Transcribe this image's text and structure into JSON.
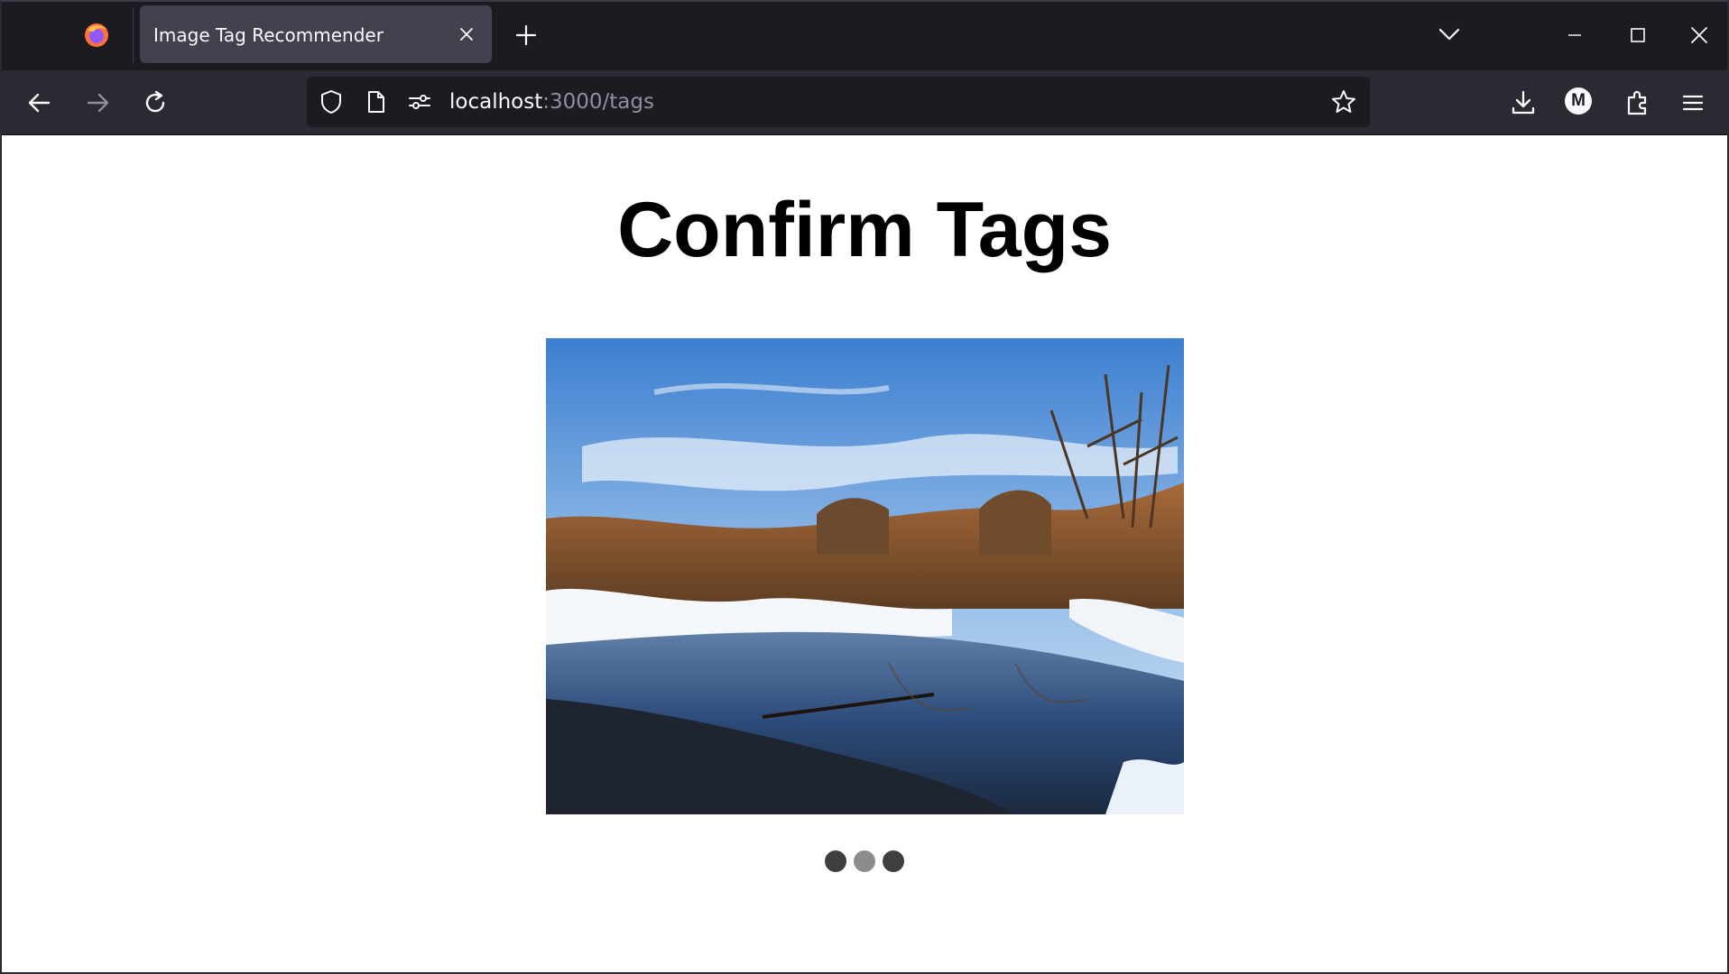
{
  "browser": {
    "tab": {
      "title": "Image Tag Recommender"
    },
    "url": {
      "host": "localhost",
      "path": ":3000/tags"
    },
    "profile": {
      "initial": "M"
    },
    "icons": {
      "app": "firefox-logo-icon",
      "tab_close": "close-icon",
      "new_tab": "plus-icon",
      "tab_list": "chevron-down-icon",
      "minimize": "minimize-icon",
      "maximize": "maximize-icon",
      "window_close": "close-icon",
      "back": "arrow-left-icon",
      "forward": "arrow-right-icon",
      "reload": "reload-icon",
      "tracking": "shield-icon",
      "page": "page-icon",
      "permissions": "permissions-icon",
      "bookmark": "star-icon",
      "downloads": "download-icon",
      "extensions": "puzzle-icon",
      "menu": "hamburger-menu-icon"
    },
    "colors": {
      "chrome_dark": "#1c1b22",
      "toolbar": "#2b2a33",
      "tab_active": "#42414d",
      "text": "#fbfbfe",
      "text_muted": "#8f8f9d"
    }
  },
  "page": {
    "heading": "Confirm Tags",
    "image": {
      "subject": "winter river landscape with snow, reeds and bare trees under a blue sky"
    },
    "carousel": {
      "count": 3,
      "dots": [
        {
          "state": "dark",
          "color": "#3f3f3f"
        },
        {
          "state": "active",
          "color": "#8c8c8c"
        },
        {
          "state": "dark",
          "color": "#3f3f3f"
        }
      ]
    }
  }
}
